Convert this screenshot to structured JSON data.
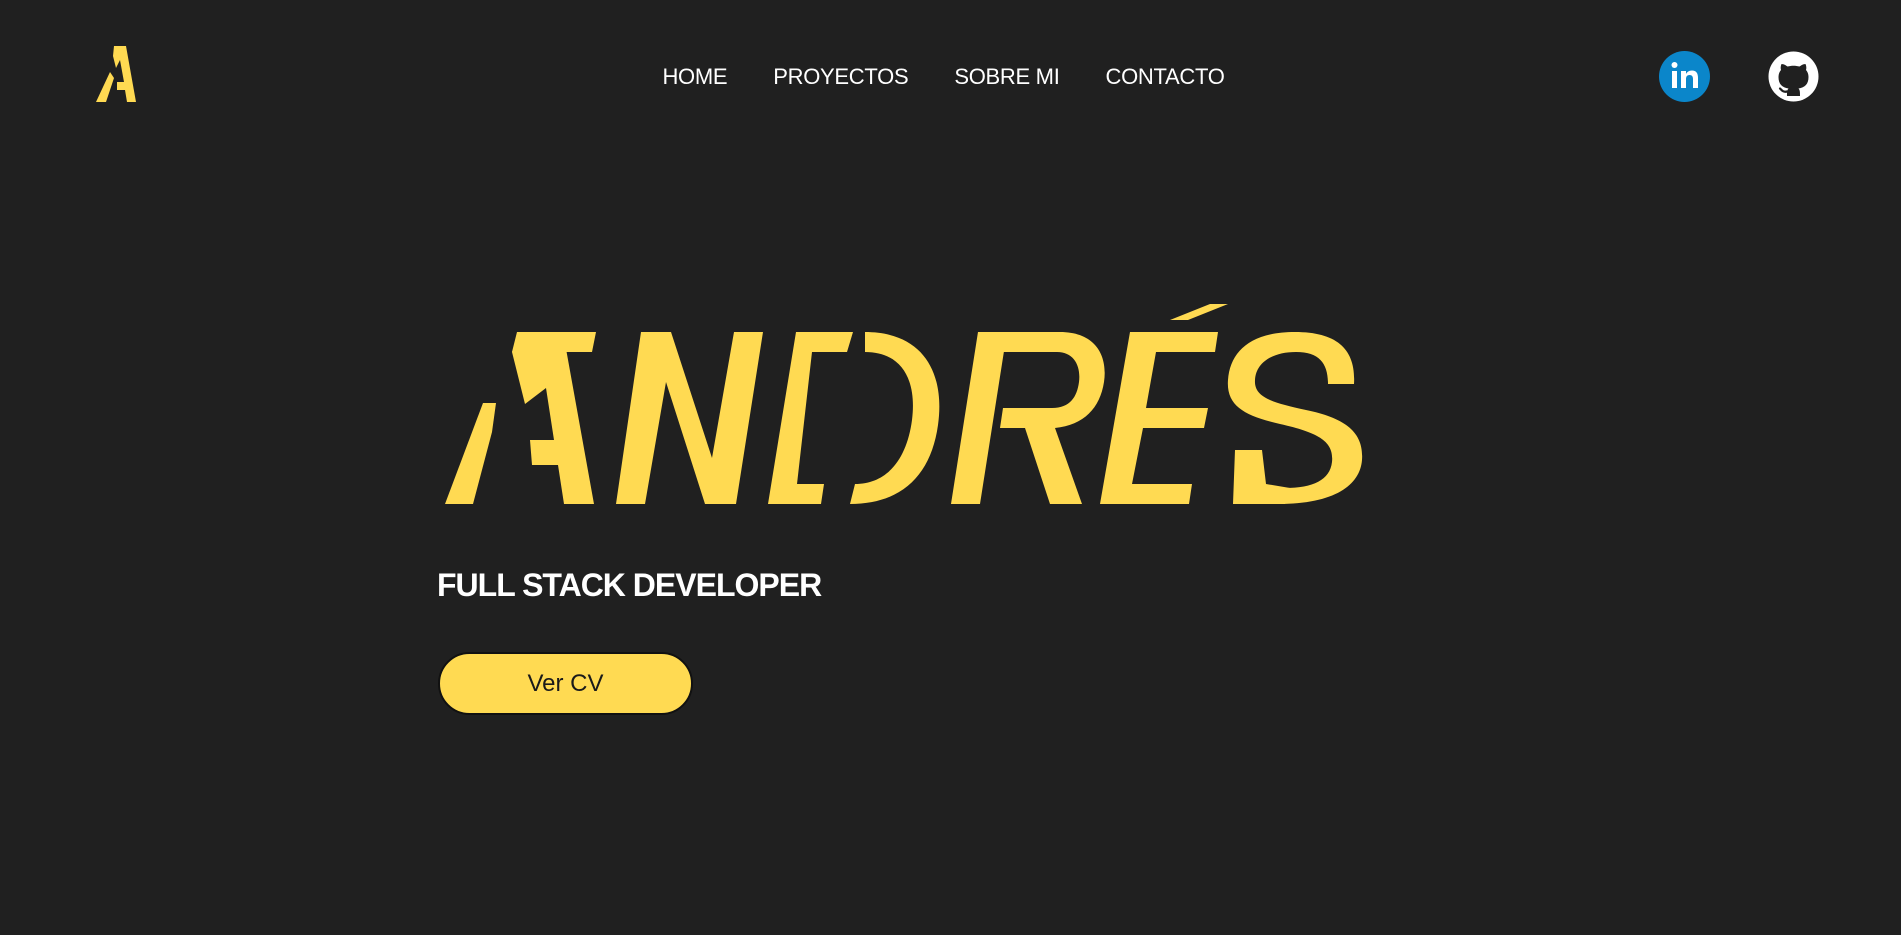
{
  "colors": {
    "background": "#202020",
    "accent": "#ffda52",
    "linkedin": "#0b86ca",
    "text": "#ffffff"
  },
  "header": {
    "logo_icon": "A",
    "nav": [
      {
        "label": "HOME"
      },
      {
        "label": "PROYECTOS"
      },
      {
        "label": "SOBRE MI"
      },
      {
        "label": "CONTACTO"
      }
    ],
    "social": [
      {
        "icon": "linkedin-icon",
        "text": "in"
      },
      {
        "icon": "github-icon"
      }
    ]
  },
  "hero": {
    "name": "ANDRÉS",
    "subtitle": "FULL STACK DEVELOPER",
    "cv_button": "Ver CV"
  }
}
